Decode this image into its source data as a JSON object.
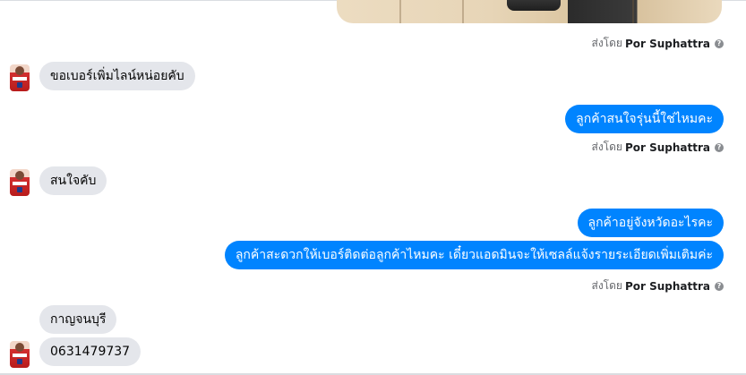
{
  "sender_label_prefix": "ส่งโดย",
  "sender_name": "Por Suphattra",
  "messages_in": [
    {
      "text": "ขอเบอร์เพิ่มไลน์หน่อยคับ"
    },
    {
      "text": "สนใจคับ"
    },
    {
      "text": "กาญจนบุรี"
    },
    {
      "text": "0631479737"
    }
  ],
  "messages_out": [
    {
      "text": "ลูกค้าสนใจรุ่นนี้ใช่ไหมคะ"
    },
    {
      "text": "ลูกค้าอยู่จังหวัดอะไรคะ"
    },
    {
      "text": "ลูกค้าสะดวกให้เบอร์ติดต่อลูกค้าไหมคะ เดี๋ยวแอดมินจะให้เซลล์แจ้งรายระเอียดเพิ่มเติมค่ะ"
    }
  ],
  "icons": {
    "info": "info-icon",
    "avatar": "user-avatar",
    "attachment": "car-interior-photo"
  },
  "colors": {
    "outgoing_bubble": "#0084ff",
    "incoming_bubble": "#e4e6eb",
    "meta_text": "#65676b"
  }
}
